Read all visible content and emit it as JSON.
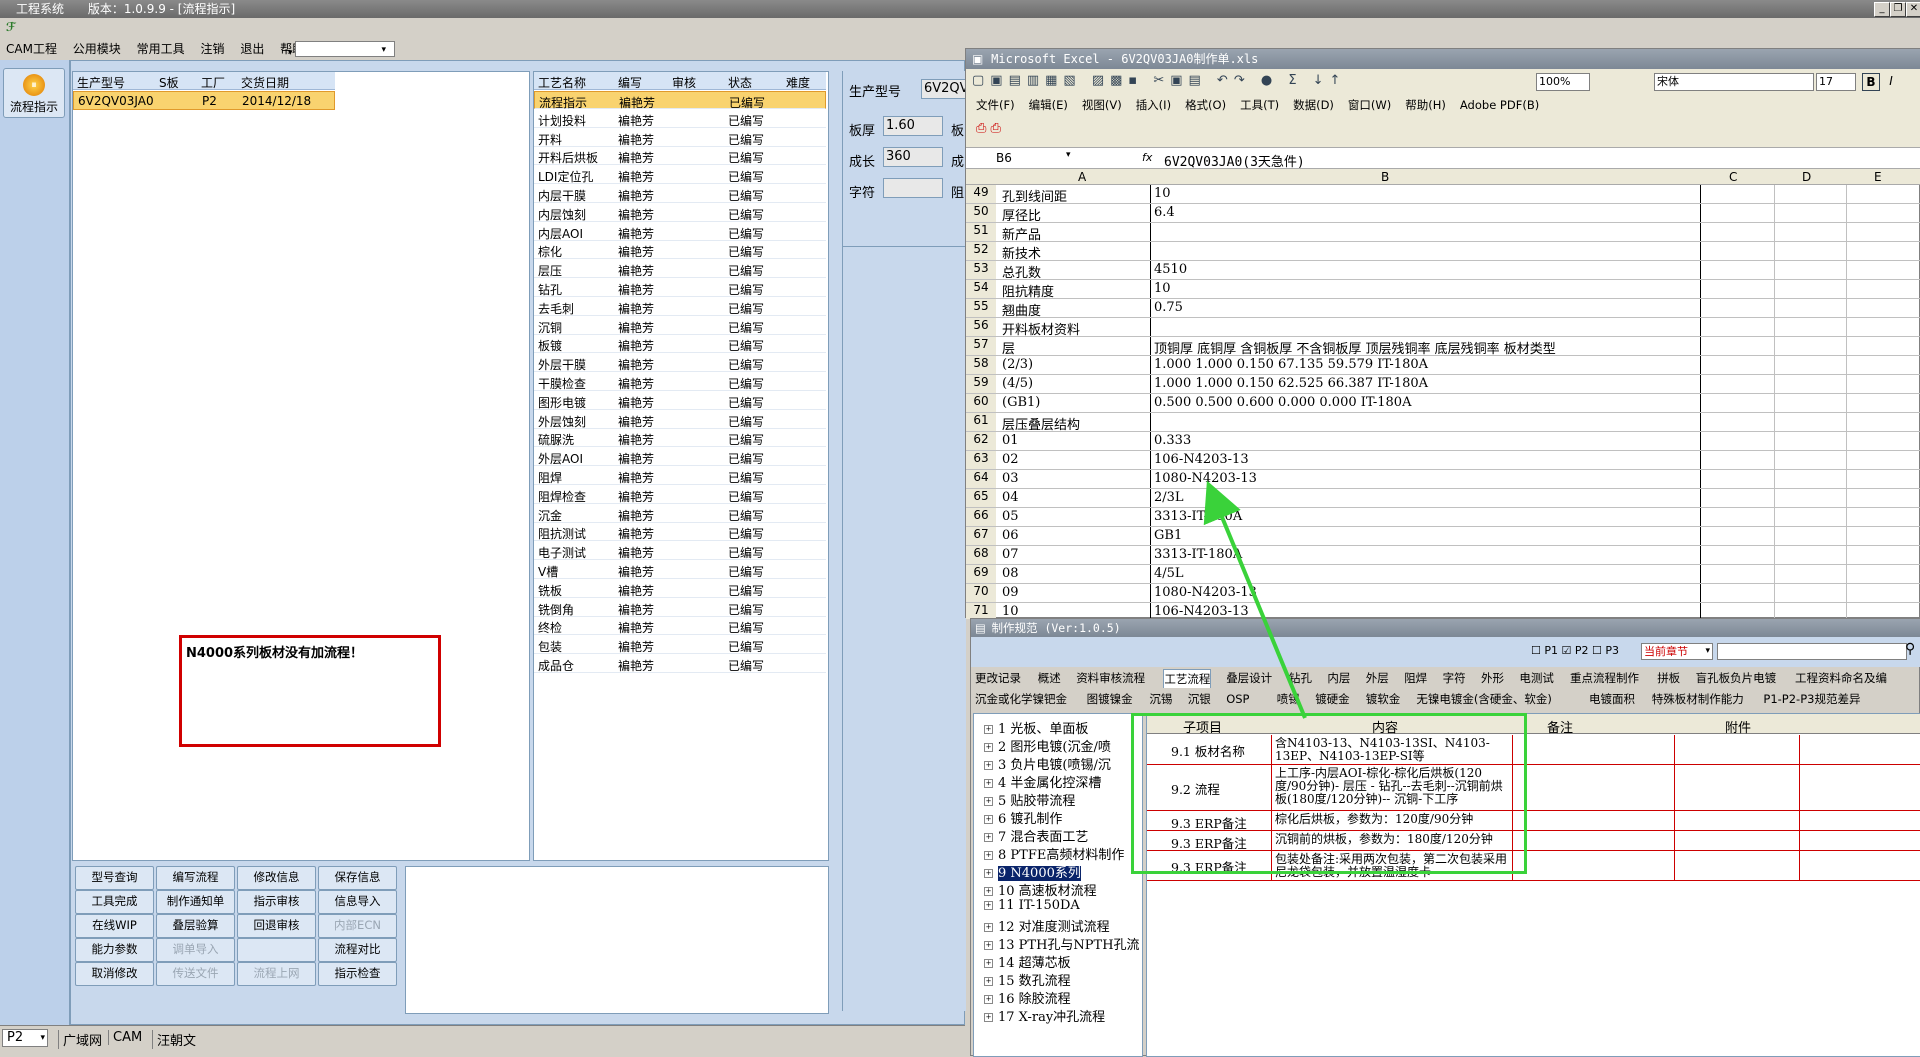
{
  "titlebar": {
    "app": "工程系统",
    "version": "版本：1.0.9.9 - [流程指示]"
  },
  "menu": [
    "CAM工程",
    "公用模块",
    "常用工具",
    "注销",
    "退出",
    "帮助"
  ],
  "sidebar": {
    "label": "流程指示"
  },
  "job_table": {
    "headers": [
      "生产型号",
      "S板",
      "工厂",
      "交货日期"
    ],
    "row": [
      "6V2QV03JA0",
      "",
      "P2",
      "2014/12/18"
    ]
  },
  "process_table": {
    "headers": [
      "工艺名称",
      "编写",
      "审核",
      "状态",
      "难度"
    ],
    "rows": [
      [
        "流程指示",
        "褊艳芳",
        "",
        "已编写",
        ""
      ],
      [
        "计划投料",
        "褊艳芳",
        "",
        "已编写",
        ""
      ],
      [
        "开料",
        "褊艳芳",
        "",
        "已编写",
        ""
      ],
      [
        "开料后烘板",
        "褊艳芳",
        "",
        "已编写",
        ""
      ],
      [
        "LDI定位孔",
        "褊艳芳",
        "",
        "已编写",
        ""
      ],
      [
        "内层干膜",
        "褊艳芳",
        "",
        "已编写",
        ""
      ],
      [
        "内层蚀刻",
        "褊艳芳",
        "",
        "已编写",
        ""
      ],
      [
        "内层AOI",
        "褊艳芳",
        "",
        "已编写",
        ""
      ],
      [
        "棕化",
        "褊艳芳",
        "",
        "已编写",
        ""
      ],
      [
        "层压",
        "褊艳芳",
        "",
        "已编写",
        ""
      ],
      [
        "钻孔",
        "褊艳芳",
        "",
        "已编写",
        ""
      ],
      [
        "去毛刺",
        "褊艳芳",
        "",
        "已编写",
        ""
      ],
      [
        "沉铜",
        "褊艳芳",
        "",
        "已编写",
        ""
      ],
      [
        "板镀",
        "褊艳芳",
        "",
        "已编写",
        ""
      ],
      [
        "外层干膜",
        "褊艳芳",
        "",
        "已编写",
        ""
      ],
      [
        "干膜检查",
        "褊艳芳",
        "",
        "已编写",
        ""
      ],
      [
        "图形电镀",
        "褊艳芳",
        "",
        "已编写",
        ""
      ],
      [
        "外层蚀刻",
        "褊艳芳",
        "",
        "已编写",
        ""
      ],
      [
        "硫脲洗",
        "褊艳芳",
        "",
        "已编写",
        ""
      ],
      [
        "外层AOI",
        "褊艳芳",
        "",
        "已编写",
        ""
      ],
      [
        "阻焊",
        "褊艳芳",
        "",
        "已编写",
        ""
      ],
      [
        "阻焊检查",
        "褊艳芳",
        "",
        "已编写",
        ""
      ],
      [
        "沉金",
        "褊艳芳",
        "",
        "已编写",
        ""
      ],
      [
        "阻抗测试",
        "褊艳芳",
        "",
        "已编写",
        ""
      ],
      [
        "电子测试",
        "褊艳芳",
        "",
        "已编写",
        ""
      ],
      [
        "V槽",
        "褊艳芳",
        "",
        "已编写",
        ""
      ],
      [
        "铣板",
        "褊艳芳",
        "",
        "已编写",
        ""
      ],
      [
        "铣倒角",
        "褊艳芳",
        "",
        "已编写",
        ""
      ],
      [
        "终检",
        "褊艳芳",
        "",
        "已编写",
        ""
      ],
      [
        "包装",
        "褊艳芳",
        "",
        "已编写",
        ""
      ],
      [
        "成品仓",
        "褊艳芳",
        "",
        "已编写",
        ""
      ]
    ]
  },
  "annotation": "N4000系列板材没有加流程！",
  "buttons": [
    [
      "型号查询",
      "编写流程",
      "修改信息",
      "保存信息"
    ],
    [
      "工具完成",
      "制作通知单",
      "指示审核",
      "信息导入"
    ],
    [
      "在线WIP",
      "叠层验算",
      "回退审核",
      "内部ECN"
    ],
    [
      "能力参数",
      "调单导入",
      "",
      "流程对比"
    ],
    [
      "取消修改",
      "传送文件",
      "流程上网",
      "指示检查"
    ]
  ],
  "info": {
    "model_label": "生产型号",
    "model_value": "6V2QV",
    "thick_label": "板厚",
    "thick_value": "1.60",
    "len_label": "成长",
    "len_value": "360",
    "char_label": "字符",
    "extra1": "板",
    "extra2": "成",
    "extra3": "阻"
  },
  "statusbar": {
    "factory": "P2",
    "net": "广域网",
    "cam": "CAM",
    "user": "汪朝文"
  },
  "excel": {
    "title": "Microsoft Excel - 6V2QV03JA0制作单.xls",
    "zoom": "100%",
    "font": "宋体",
    "size": "17",
    "menu": [
      "文件(F)",
      "编辑(E)",
      "视图(V)",
      "插入(I)",
      "格式(O)",
      "工具(T)",
      "数据(D)",
      "窗口(W)",
      "帮助(H)",
      "Adobe PDF(B)"
    ],
    "namebox": "B6",
    "formula": "6V2QV03JA0(3天急件)",
    "cols": [
      "A",
      "B",
      "C",
      "D",
      "E"
    ],
    "rows": [
      [
        "49",
        "孔到线间距",
        "10"
      ],
      [
        "50",
        "厚径比",
        "6.4"
      ],
      [
        "51",
        "新产品",
        ""
      ],
      [
        "52",
        "新技术",
        ""
      ],
      [
        "53",
        "总孔数",
        "4510"
      ],
      [
        "54",
        "阻抗精度",
        "10"
      ],
      [
        "55",
        "翘曲度",
        "0.75"
      ],
      [
        "56",
        "开料板材资料",
        ""
      ],
      [
        "57",
        "层",
        "顶铜厚  底铜厚  含铜板厚  不含铜板厚  顶层残铜率  底层残铜率  板材类型"
      ],
      [
        "58",
        "(2/3)",
        "1.000  1.000       0.150     67.135    59.579     IT-180A"
      ],
      [
        "59",
        "(4/5)",
        "1.000  1.000       0.150     62.525    66.387     IT-180A"
      ],
      [
        "60",
        "(GB1)",
        "0.500  0.500       0.600     0.000     0.000      IT-180A"
      ],
      [
        "61",
        "层压叠层结构",
        ""
      ],
      [
        "62",
        "01",
        "0.333"
      ],
      [
        "63",
        "02",
        "106-N4203-13"
      ],
      [
        "64",
        "03",
        "1080-N4203-13"
      ],
      [
        "65",
        "04",
        "2/3L"
      ],
      [
        "66",
        "05",
        "3313-IT-180A"
      ],
      [
        "67",
        "06",
        "GB1"
      ],
      [
        "68",
        "07",
        "3313-IT-180A"
      ],
      [
        "69",
        "08",
        "4/5L"
      ],
      [
        "70",
        "09",
        "1080-N4203-13"
      ],
      [
        "71",
        "10",
        "106-N4203-13"
      ]
    ]
  },
  "spec": {
    "title": "制作规范 (Ver:1.0.5)",
    "p1": "P1",
    "p2": "P2",
    "p3": "P3",
    "scope": "当前章节",
    "tabs1": [
      "更改记录",
      "概述",
      "资料审核流程",
      "工艺流程",
      "叠层设计",
      "钻孔",
      "内层",
      "外层",
      "阻焊",
      "字符",
      "外形",
      "电测试",
      "重点流程制作",
      "拼板",
      "盲孔板负片电镀",
      "工程资料命名及编"
    ],
    "tabs2": [
      "沉金或化学镍钯金",
      "图镀镍金",
      "沉锡",
      "沉银",
      "OSP",
      "喷锡",
      "镀硬金",
      "镀软金",
      "无镍电镀金(含硬金、软金)",
      "电镀面积",
      "特殊板材制作能力",
      "P1-P2-P3规范差异"
    ],
    "tree": [
      "1 光板、单面板",
      "2 图形电镀(沉金/喷",
      "3 负片电镀(喷锡/沉",
      "4 半金属化控深槽",
      "5 贴胶带流程",
      "6 镀孔制作",
      "7 混合表面工艺",
      "8 PTFE高频材料制作",
      "9 N4000系列",
      "10 高速板材流程",
      "11 IT-150DA",
      "12 对准度测试流程",
      "13 PTH孔与NPTH孔流",
      "14 超薄芯板",
      "15 数孔流程",
      "16 除胶流程",
      "17 X-ray冲孔流程"
    ],
    "headers": [
      "子项目",
      "内容",
      "备注",
      "附件"
    ],
    "rows": [
      [
        "9.1 板材名称",
        "含N4103-13、N4103-13SI、N4103-13EP、N4103-13EP-SI等"
      ],
      [
        "9.2 流程",
        "上工序-内层AOI-棕化-棕化后烘板(120度/90分钟)- 层压 - 钻孔--去毛刺--沉铜前烘板(180度/120分钟)-- 沉铜-下工序"
      ],
      [
        "9.3 ERP备注",
        "棕化后烘板，参数为：120度/90分钟"
      ],
      [
        "9.3 ERP备注",
        "沉铜前的烘板，参数为：180度/120分钟"
      ],
      [
        "9.3 ERP备注",
        "包装处备注:采用两次包装，第二次包装采用尼龙袋包装，并放置温湿度卡"
      ]
    ]
  }
}
